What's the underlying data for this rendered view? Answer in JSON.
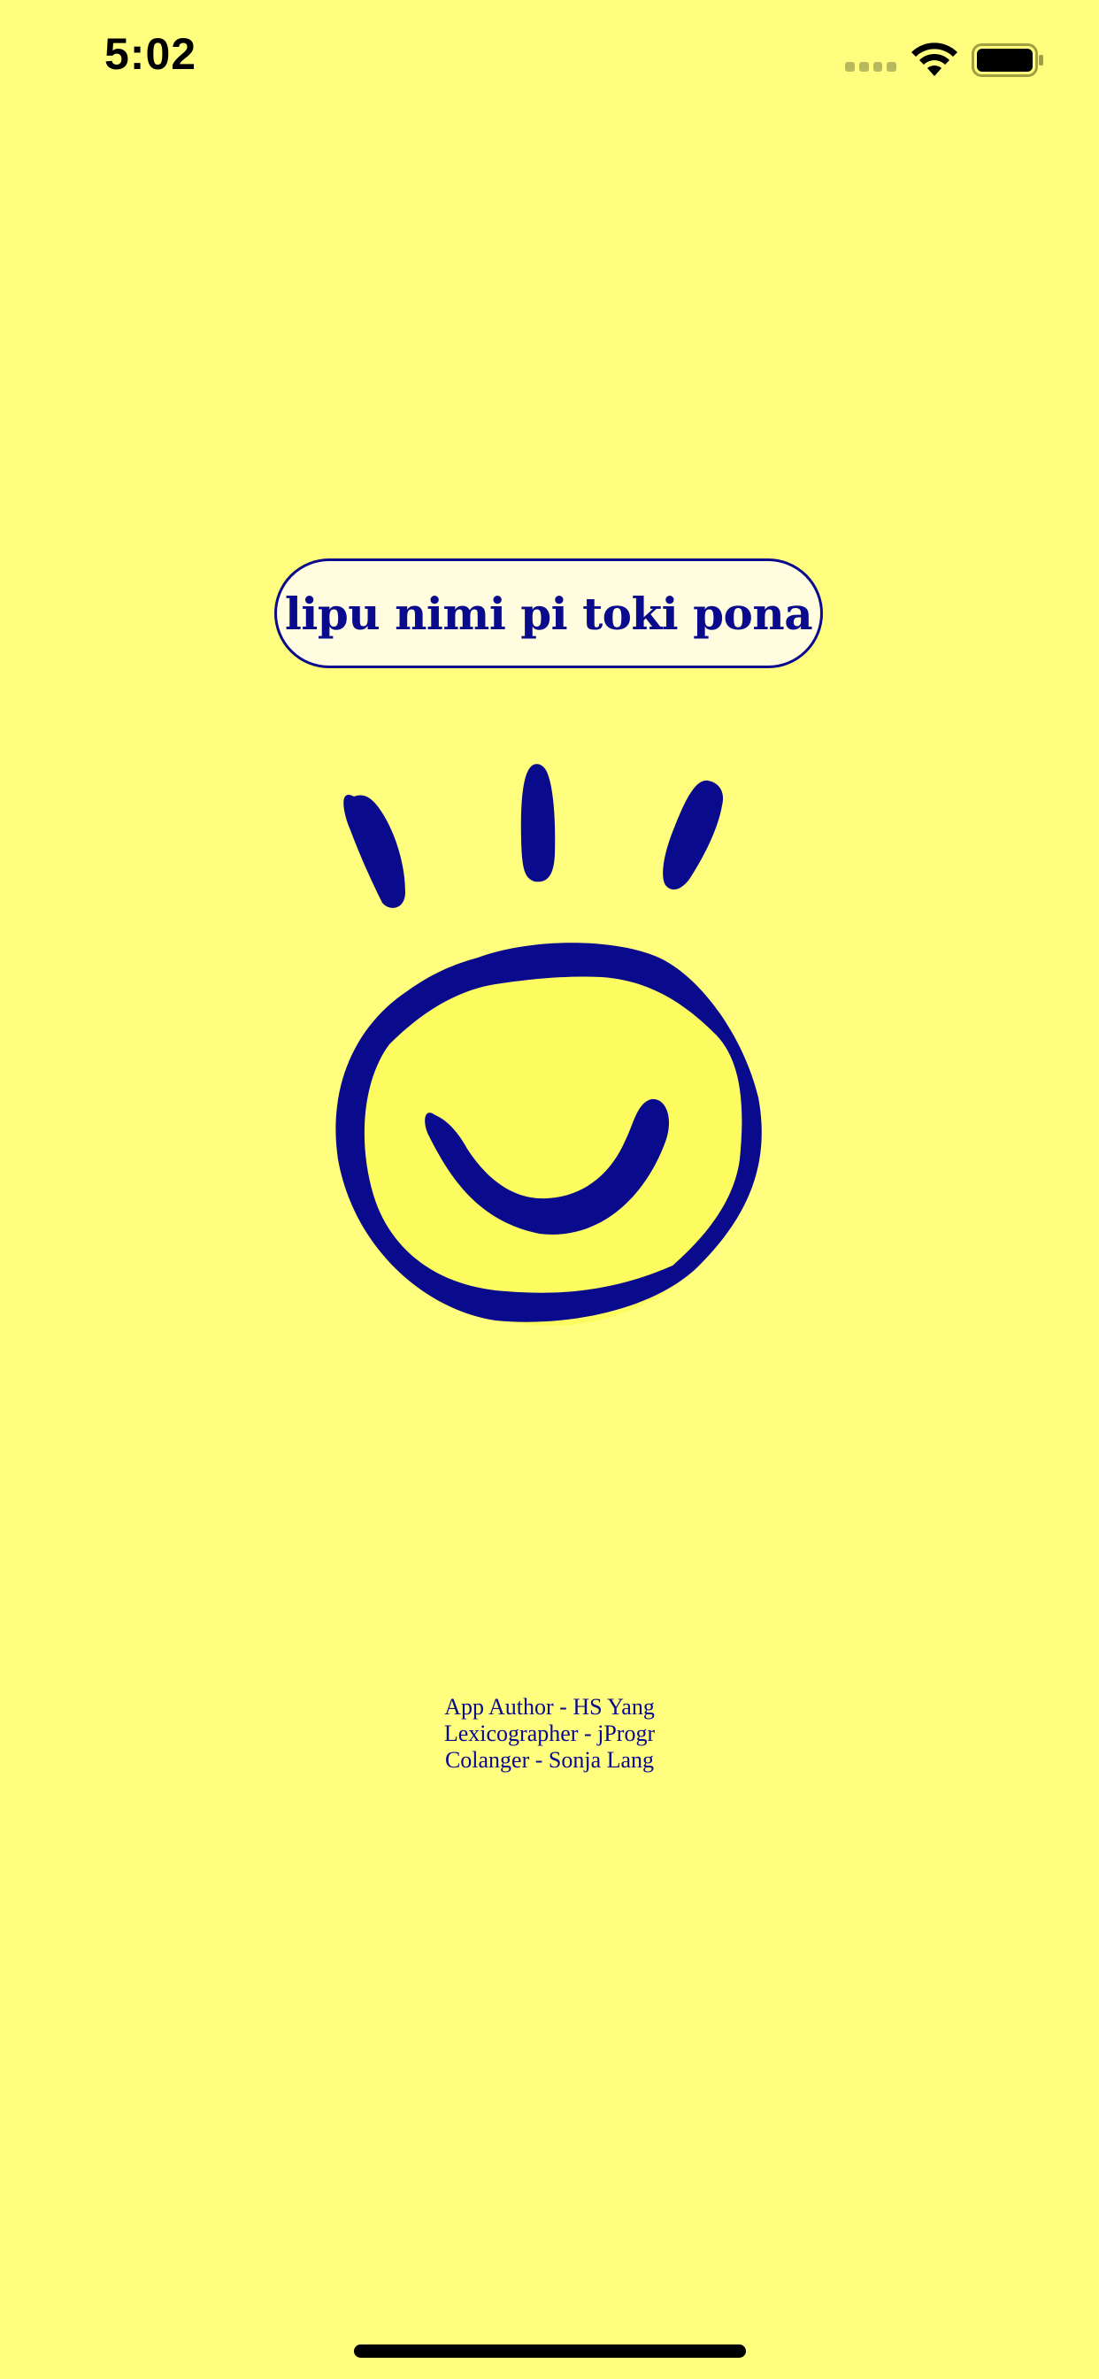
{
  "status_bar": {
    "time": "5:02",
    "icons": [
      "cellular-signal-icon",
      "wifi-icon",
      "battery-icon"
    ]
  },
  "title_button": {
    "label": "lipu nimi pi toki pona"
  },
  "logo": {
    "icon": "smiling-sun-icon"
  },
  "credits": {
    "lines": [
      "App Author - HS Yang",
      "Lexicographer - jProgr",
      "Colanger - Sonja Lang"
    ]
  },
  "colors": {
    "background": "#FFFE7E",
    "accent": "#0A0A8C",
    "pill_fill": "#FFFCE0",
    "sun_fill": "#FCFC60"
  }
}
